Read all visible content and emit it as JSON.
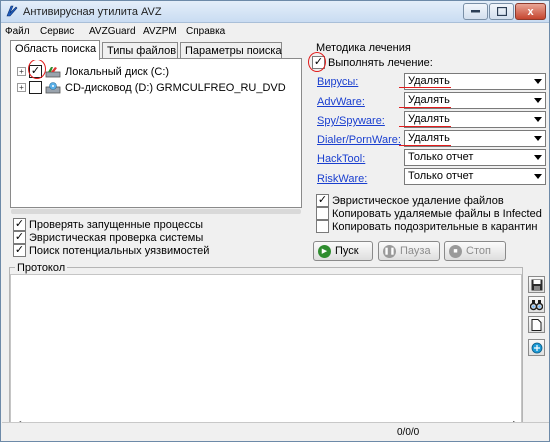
{
  "window": {
    "title": "Антивирусная утилита AVZ",
    "close_label": "x"
  },
  "menu": [
    "Файл",
    "Сервис",
    "AVZGuard",
    "AVZPM",
    "Справка"
  ],
  "tabs": [
    "Область поиска",
    "Типы файлов",
    "Параметры поиска"
  ],
  "tree": [
    {
      "label": "Локальный диск (C:)",
      "checked": true
    },
    {
      "label": "CD-дисковод (D:) GRMCULFREO_RU_DVD",
      "checked": false
    }
  ],
  "scan_options": [
    {
      "label": "Проверять запущенные процессы",
      "checked": true
    },
    {
      "label": "Эвристическая проверка системы",
      "checked": true
    },
    {
      "label": "Поиск потенциальных уязвимостей",
      "checked": true
    }
  ],
  "treatment": {
    "group_title": "Методика лечения",
    "perform_label": "Выполнять лечение:",
    "rows": [
      {
        "label": "Вирусы:",
        "value": "Удалять"
      },
      {
        "label": "AdvWare:",
        "value": "Удалять"
      },
      {
        "label": "Spy/Spyware:",
        "value": "Удалять"
      },
      {
        "label": "Dialer/PornWare:",
        "value": "Удалять"
      },
      {
        "label": "HackTool:",
        "value": "Только отчет"
      },
      {
        "label": "RiskWare:",
        "value": "Только отчет"
      }
    ],
    "extra_options": [
      {
        "label": "Эвристическое удаление файлов",
        "checked": true
      },
      {
        "label": "Копировать удаляемые файлы в  Infected",
        "checked": false
      },
      {
        "label": "Копировать подозрительные в  карантин",
        "checked": false
      }
    ]
  },
  "buttons": {
    "start": "Пуск",
    "pause": "Пауза",
    "stop": "Стоп"
  },
  "protocol": {
    "label": "Протокол"
  },
  "status": {
    "counter": "0/0/0"
  },
  "colors": {
    "link": "#1a3fcf",
    "annotation_red": "#e21b1b",
    "start_icon": "#2f8d2f"
  }
}
